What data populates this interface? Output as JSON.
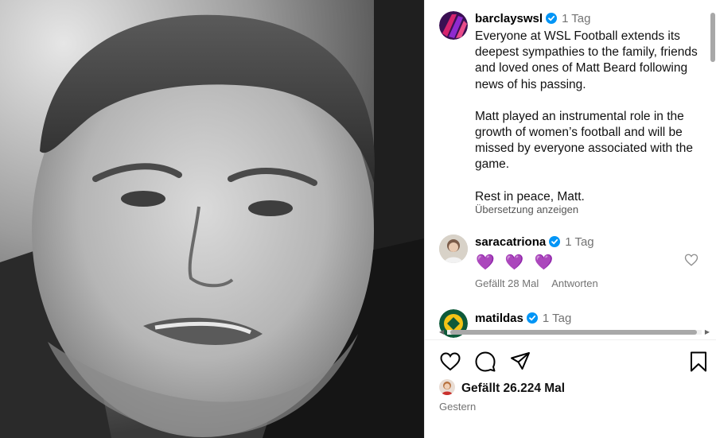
{
  "post": {
    "username": "barclayswsl",
    "time": "1 Tag",
    "caption_lines": [
      "Everyone at WSL Football extends its deepest sympathies to the family, friends and loved ones of Matt Beard following news of his passing.",
      "Matt played an instrumental role in the growth of women’s football and will be missed by everyone associated with the game.",
      "Rest in peace, Matt."
    ],
    "translate_label": "Übersetzung anzeigen"
  },
  "comments": [
    {
      "username": "saracatriona",
      "time": "1 Tag",
      "text": "💜 💜 💜",
      "likes": "Gefällt 28 Mal",
      "reply": "Antworten"
    },
    {
      "username": "matildas",
      "time": "1 Tag"
    }
  ],
  "footer": {
    "likes": "Gefällt 26.224 Mal",
    "date": "Gestern"
  },
  "colors": {
    "verified": "#0095f6",
    "muted": "#737373",
    "hearts": "#8a3fe0"
  }
}
